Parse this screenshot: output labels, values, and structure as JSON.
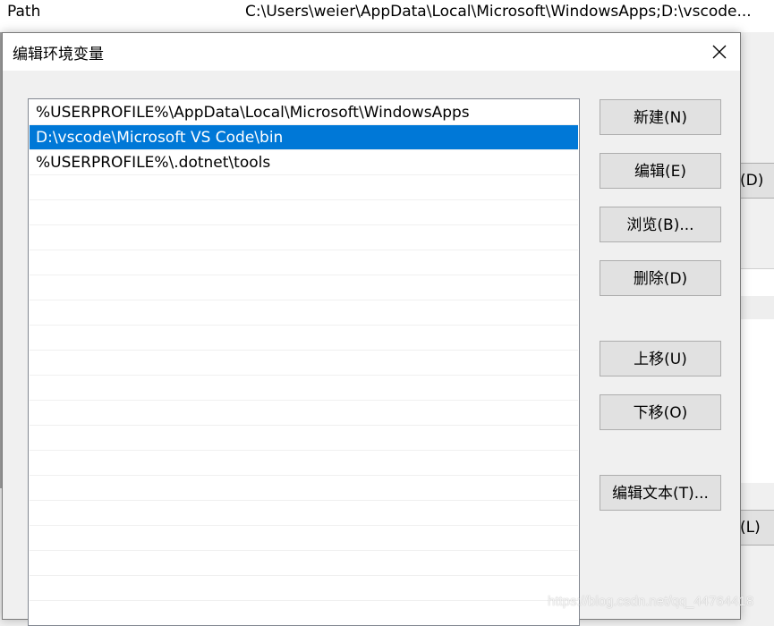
{
  "background": {
    "row": {
      "name": "Path",
      "value": "C:\\Users\\weier\\AppData\\Local\\Microsoft\\WindowsApps;D:\\vscode..."
    },
    "button_fragments": [
      "(D)",
      "(L)"
    ]
  },
  "dialog": {
    "title": "编辑环境变量",
    "close_icon": "close-icon",
    "list": {
      "items": [
        "%USERPROFILE%\\AppData\\Local\\Microsoft\\WindowsApps",
        "D:\\vscode\\Microsoft VS Code\\bin",
        "%USERPROFILE%\\.dotnet\\tools"
      ],
      "selected_index": 1
    },
    "buttons": {
      "new": "新建(N)",
      "edit": "编辑(E)",
      "browse": "浏览(B)...",
      "delete": "删除(D)",
      "move_up": "上移(U)",
      "move_down": "下移(O)",
      "edit_text": "编辑文本(T)..."
    }
  },
  "watermark": "https://blog.csdn.net/qq_44764418",
  "colors": {
    "selection": "#0078d7",
    "button_face": "#e1e1e1",
    "button_border": "#adadad"
  }
}
